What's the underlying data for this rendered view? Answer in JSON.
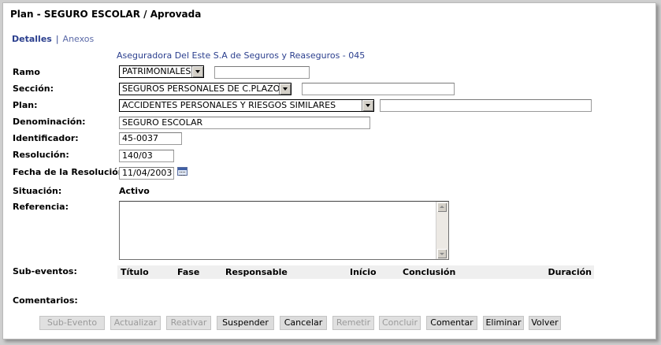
{
  "header": {
    "title": "Plan - SEGURO ESCOLAR / Aprovada"
  },
  "tabs": [
    {
      "label": "Detalles",
      "active": true
    },
    {
      "label": "Anexos",
      "active": false
    }
  ],
  "tab_separator": "|",
  "insurer": "Aseguradora Del Este S.A de Seguros y Reaseguros - 045",
  "form": {
    "ramo": {
      "label": "Ramo",
      "selected": "PATRIMONIALES",
      "extra_value": ""
    },
    "seccion": {
      "label": "Sección:",
      "selected": "SEGUROS PERSONALES DE C.PLAZO",
      "extra_value": ""
    },
    "plan": {
      "label": "Plan:",
      "selected": "ACCIDENTES PERSONALES Y RIESGOS SIMILARES",
      "extra_value": ""
    },
    "denominacion": {
      "label": "Denominación:",
      "value": "SEGURO ESCOLAR"
    },
    "identificador": {
      "label": "Identificador:",
      "value": "45-0037"
    },
    "resolucion": {
      "label": "Resolución:",
      "value": "140/03"
    },
    "fecha_resolucion": {
      "label": "Fecha de la Resolución:",
      "value": "11/04/2003",
      "icon": "calendar-icon"
    },
    "situacion": {
      "label": "Situación:",
      "value": "Activo"
    },
    "referencia": {
      "label": "Referencia:",
      "value": ""
    }
  },
  "sub_eventos": {
    "label": "Sub-eventos:",
    "columns": [
      "Título",
      "Fase",
      "Responsable",
      "Início",
      "Conclusión",
      "Duración"
    ]
  },
  "comentarios": {
    "label": "Comentarios:"
  },
  "buttons": [
    {
      "label": "Sub-Evento",
      "enabled": false
    },
    {
      "label": "Actualizar",
      "enabled": false
    },
    {
      "label": "Reativar",
      "enabled": false
    },
    {
      "label": "Suspender",
      "enabled": true
    },
    {
      "label": "Cancelar",
      "enabled": true
    },
    {
      "label": "Remetir",
      "enabled": false
    },
    {
      "label": "Concluir",
      "enabled": false
    },
    {
      "label": "Comentar",
      "enabled": true
    },
    {
      "label": "Eliminar",
      "enabled": true
    },
    {
      "label": "Volver",
      "enabled": true
    }
  ]
}
